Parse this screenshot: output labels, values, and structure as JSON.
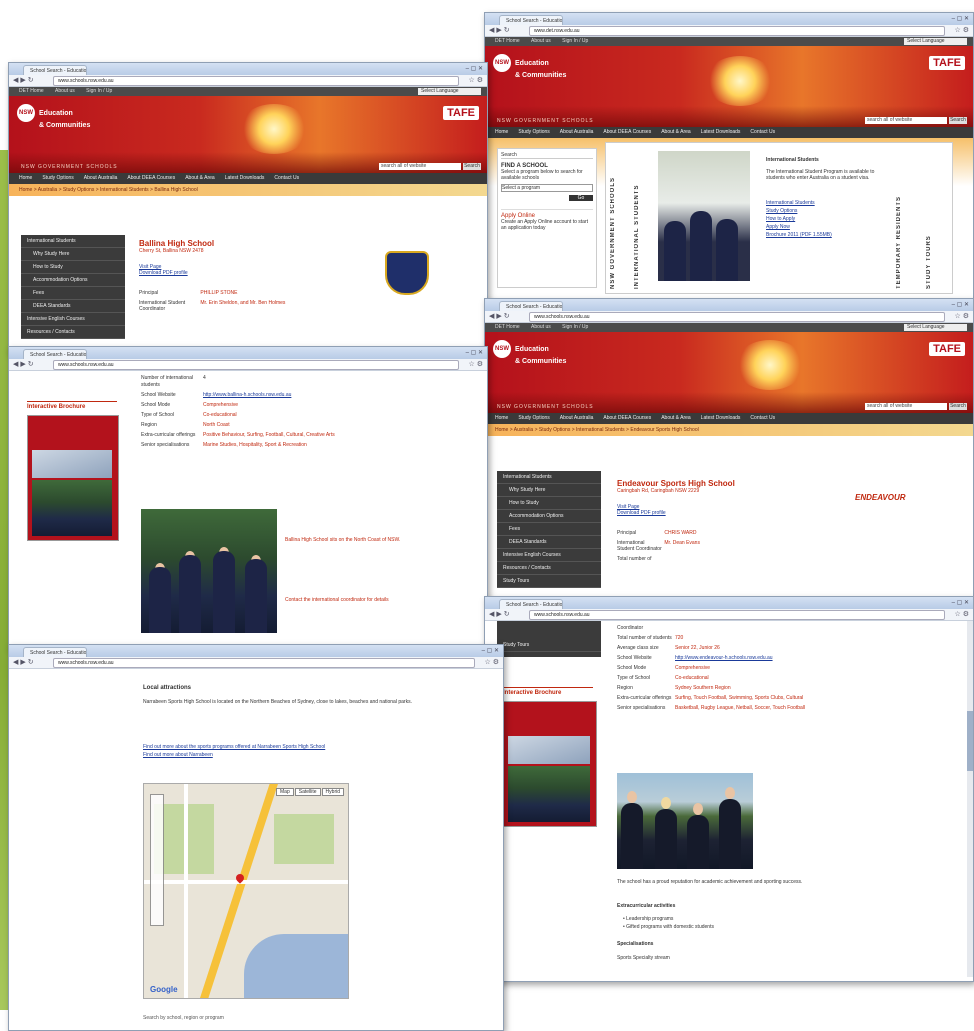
{
  "browser": {
    "tab_title": "School Search - Education...",
    "url_dalirl": "www.schools.nsw.edu.au",
    "url_int": "www.det.nsw.edu.au"
  },
  "site": {
    "util_links": [
      "DET Home",
      "About us",
      "Sign In / Up"
    ],
    "select_language": "Select Language",
    "nsw_label": "NSW",
    "dept_name_1": "Education",
    "dept_name_2": "& Communities",
    "tafe": "TAFE",
    "hgs": "NSW GOVERNMENT SCHOOLS",
    "search_placeholder": "search all of website",
    "search_button": "Search",
    "menu": [
      "Home",
      "Study Options",
      "About Australia",
      "About DEEA Courses",
      "About & Area",
      "Latest Downloads",
      "Contact Us"
    ]
  },
  "win1": {
    "breadcrumb": "Home > Australia > Study Options > International Students > Ballina High School",
    "sidebar": [
      "International Students",
      "Why Study Here",
      "How to Study",
      "Accommodation Options",
      "Fees",
      "DEEA Standards",
      "Intensive English Courses",
      "Resources / Contacts"
    ],
    "school_name": "Ballina High School",
    "address": "Cherry St, Ballina NSW 2478",
    "links": [
      "Visit Page",
      "Download PDF profile"
    ],
    "principal_label": "Principal",
    "principal_val": "PHILLIP STONE",
    "isc_label": "International Student Coordinator",
    "isc_val": "Mr. Erin Sheldon, and Mr. Ben Holmes"
  },
  "win2": {
    "brochure_heading": "Interactive Brochure",
    "rows": [
      {
        "label": "Number of international students",
        "val": "4"
      },
      {
        "label": "School Website",
        "val": "http://www.ballina-h.schools.nsw.edu.au"
      },
      {
        "label": "School Mode",
        "val": "Comprehensive"
      },
      {
        "label": "Type of School",
        "val": "Co-educational"
      },
      {
        "label": "Region",
        "val": "North Coast"
      },
      {
        "label": "Extra-curricular offerings",
        "val": "Positive Behaviour, Surfing, Football, Cultural, Creative Arts"
      },
      {
        "label": "Senior specialisations",
        "val": "Marine Studies, Hospitality, Sport & Recreation"
      }
    ],
    "caption": "Ballina High School sits on the North Coast of NSW.",
    "contact": "Contact the international coordinator for details"
  },
  "win3": {
    "section_title": "Local attractions",
    "para": "Narrabeen Sports High School is located on the Northern Beaches of Sydney, close to lakes, beaches and national parks.",
    "links": [
      "Find out more about the sports programs offered at Narrabeen Sports High School",
      "Find out more about Narrabeen"
    ],
    "map_buttons": [
      "Map",
      "Satellite",
      "Hybrid"
    ],
    "map_credit": "Google",
    "footnote": "Search by school, region or program"
  },
  "win4": {
    "search_tab": "Search",
    "find_school": "FIND A SCHOOL",
    "find_desc": "Select a program below to search for available schools",
    "select_program": "Select a program",
    "go": "Go",
    "apply": "Apply Online",
    "apply_desc": "Create an Apply Online account to start an application today",
    "vtabs": [
      "NSW GOVERNMENT SCHOOLS",
      "INTERNATIONAL STUDENTS",
      "TEMPORARY RESIDENTS",
      "STUDY TOURS"
    ],
    "intl_heading": "International Students",
    "intl_desc": "The International Student Program is available to students who enter Australia on a student visa.",
    "links": [
      "International Students",
      "Study Options",
      "How to Apply",
      "Apply Now",
      "Brochure 2011 (PDF 1.55MB)"
    ]
  },
  "win5": {
    "breadcrumb": "Home > Australia > Study Options > International Students > Endeavour Sports High School",
    "sidebar": [
      "International Students",
      "Why Study Here",
      "How to Study",
      "Accommodation Options",
      "Fees",
      "DEEA Standards",
      "Intensive English Courses",
      "Resources / Contacts",
      "Study Tours"
    ],
    "school_name": "Endeavour Sports High School",
    "address": "Caringbah Rd, Caringbah NSW 2229",
    "links": [
      "Visit Page",
      "Download PDF profile"
    ],
    "logo_text": "ENDEAVOUR",
    "principal_label": "Principal",
    "principal_val": "CHRIS WARD",
    "isc_label": "International Student Coordinator",
    "isc_val": "Mr. Dean Evans",
    "total_label": "Total number of"
  },
  "win6": {
    "sidebar_tail": [
      "Study Tours"
    ],
    "brochure_heading": "Interactive Brochure",
    "rows": [
      {
        "label": "Coordinator",
        "val": ""
      },
      {
        "label": "Total number of students",
        "val": "720"
      },
      {
        "label": "Average class size",
        "val": "Senior 22, Junior 26"
      },
      {
        "label": "School Website",
        "val": "http://www.endeavour-h.schools.nsw.edu.au"
      },
      {
        "label": "School Mode",
        "val": "Comprehensive"
      },
      {
        "label": "Type of School",
        "val": "Co-educational"
      },
      {
        "label": "Region",
        "val": "Sydney Southern Region"
      },
      {
        "label": "Extra-curricular offerings",
        "val": "Surfing, Touch Football, Swimming, Sports Clubs, Cultural"
      },
      {
        "label": "Senior specialisations",
        "val": "Basketball, Rugby League, Netball, Soccer, Touch Football"
      }
    ],
    "body": "The school has a proud reputation for academic achievement and sporting success.",
    "extra_title": "Extracurricular activities",
    "extras": [
      "Leadership programs",
      "Gifted programs with domestic students"
    ],
    "special_title": "Specialisations",
    "special": "Sports Specialty stream"
  }
}
